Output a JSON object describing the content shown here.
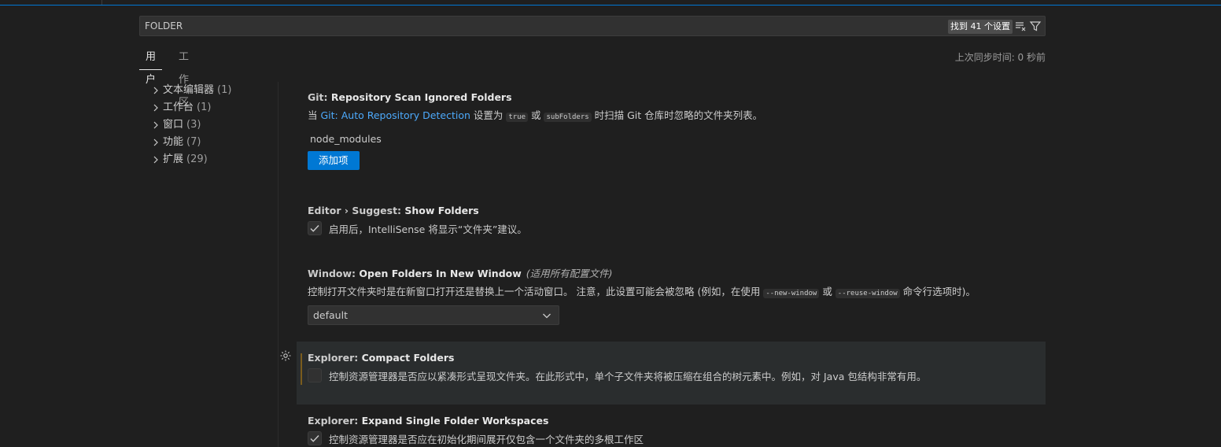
{
  "search": {
    "value": "FOLDER",
    "result_count": "找到 41 个设置",
    "icons": [
      "clear-filter-icon",
      "filter-icon"
    ]
  },
  "tabs": [
    {
      "label": "用户",
      "active": true
    },
    {
      "label": "工作区",
      "active": false
    }
  ],
  "sync_status": "上次同步时间: 0 秒前",
  "toc": [
    {
      "label": "文本编辑器",
      "count": "(1)"
    },
    {
      "label": "工作台",
      "count": "(1)"
    },
    {
      "label": "窗口",
      "count": "(3)"
    },
    {
      "label": "功能",
      "count": "(7)"
    },
    {
      "label": "扩展",
      "count": "(29)"
    }
  ],
  "settings": {
    "git_scan": {
      "category": "Git: ",
      "name": "Repository Scan Ignored Folders",
      "desc_pre": "当 ",
      "desc_link": "Git: Auto Repository Detection",
      "desc_mid1": " 设置为 ",
      "code1": "true",
      "desc_mid2": " 或 ",
      "code2": "subFolders",
      "desc_post": " 时扫描 Git 仓库时忽略的文件夹列表。",
      "items": [
        "node_modules"
      ],
      "add_label": "添加项"
    },
    "suggest_folders": {
      "category": "Editor › Suggest: ",
      "name": "Show Folders",
      "desc": "启用后，IntelliSense 将显示“文件夹”建议。",
      "checked": true
    },
    "open_folders": {
      "category": "Window: ",
      "name": "Open Folders In New Window",
      "scope": "(适用所有配置文件)",
      "desc_pre": "控制打开文件夹时是在新窗口打开还是替换上一个活动窗口。 注意，此设置可能会被忽略 (例如，在使用 ",
      "code1": "--new-window",
      "desc_mid": " 或 ",
      "code2": "--reuse-window",
      "desc_post": " 命令行选项时)。",
      "value": "default"
    },
    "compact_folders": {
      "category": "Explorer: ",
      "name": "Compact Folders",
      "desc": "控制资源管理器是否应以紧凑形式呈现文件夹。在此形式中，单个子文件夹将被压缩在组合的树元素中。例如，对 Java 包结构非常有用。",
      "checked": false
    },
    "expand_single": {
      "category": "Explorer: ",
      "name": "Expand Single Folder Workspaces",
      "desc": "控制资源管理器是否应在初始化期间展开仅包含一个文件夹的多根工作区",
      "checked": true
    }
  },
  "colors": {
    "accent": "#0078d4",
    "link": "#4daafc",
    "modified_bar": "#7a5c1d"
  }
}
